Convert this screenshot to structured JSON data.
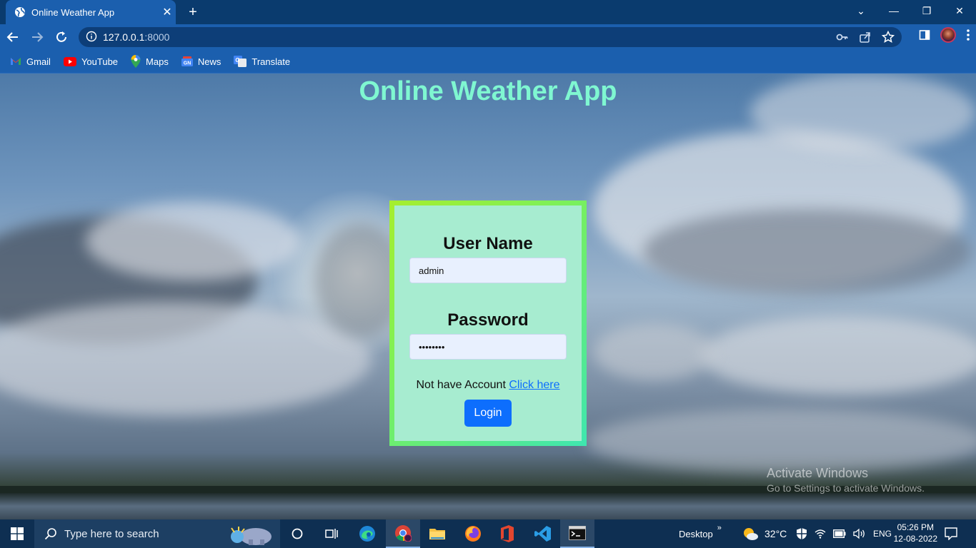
{
  "browser": {
    "tab_title": "Online Weather App",
    "url_host": "127.0.0.1",
    "url_port": ":8000",
    "bookmarks": [
      {
        "label": "Gmail",
        "icon": "gmail-icon"
      },
      {
        "label": "YouTube",
        "icon": "youtube-icon"
      },
      {
        "label": "Maps",
        "icon": "maps-icon"
      },
      {
        "label": "News",
        "icon": "news-icon"
      },
      {
        "label": "Translate",
        "icon": "translate-icon"
      }
    ]
  },
  "page": {
    "heading": "Online Weather App",
    "username_label": "User Name",
    "username_value": "admin",
    "password_label": "Password",
    "password_value": "adminpwd",
    "signup_text": "Not have Account",
    "signup_link": "Click here",
    "login_button": "Login",
    "watermark_title": "Activate Windows",
    "watermark_sub": "Go to Settings to activate Windows."
  },
  "taskbar": {
    "search_placeholder": "Type here to search",
    "desktop_label": "Desktop",
    "temperature": "32°C",
    "language": "ENG",
    "time": "05:26 PM",
    "date": "12-08-2022"
  },
  "colors": {
    "heading": "#7ff7d1",
    "login_button": "#0d6efd",
    "chrome_blue": "#1b5fae"
  }
}
